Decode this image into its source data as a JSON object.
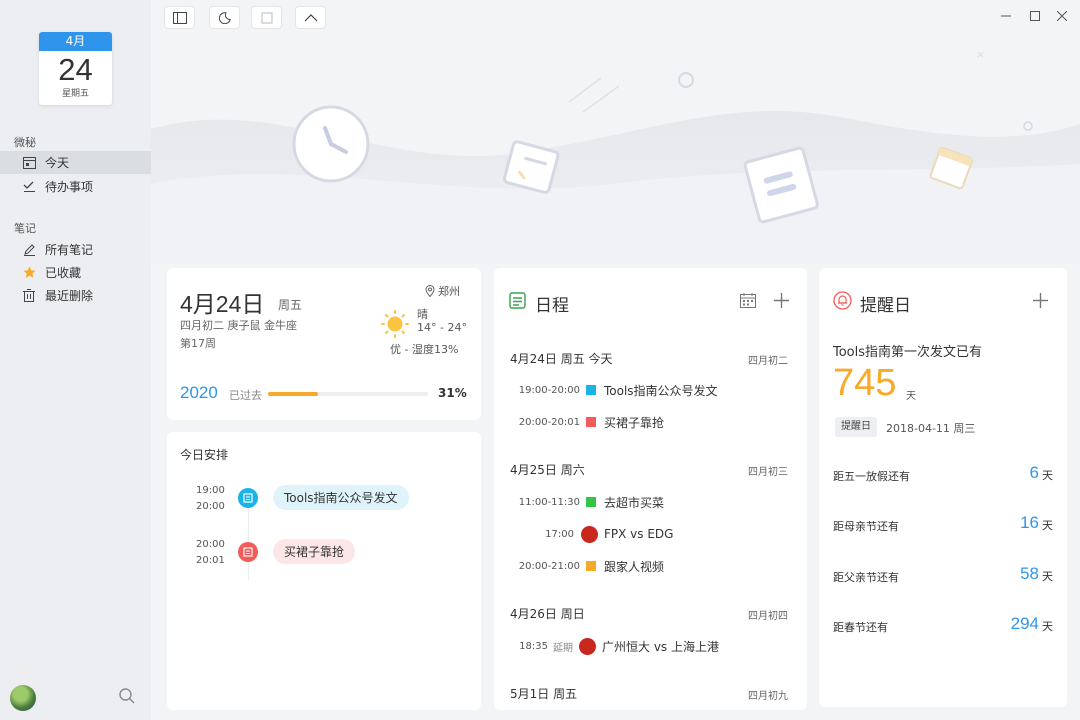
{
  "sidebar": {
    "cal_month": "4月",
    "cal_day": "24",
    "cal_weekday": "星期五",
    "section1": "微秘",
    "section2": "笔记",
    "items": [
      {
        "label": "今天",
        "icon": "calendar-icon"
      },
      {
        "label": "待办事项",
        "icon": "todo-check-icon"
      },
      {
        "label": "所有笔记",
        "icon": "pencil-icon"
      },
      {
        "label": "已收藏",
        "icon": "star-icon"
      },
      {
        "label": "最近删除",
        "icon": "trash-icon"
      }
    ]
  },
  "today": {
    "date": "4月24日",
    "weekday": "周五",
    "lunar": "四月初二 庚子鼠 金牛座",
    "week": "第17周",
    "city": "郑州",
    "weather": "晴",
    "temp": "14° - 24°",
    "air": "优 - 湿度13%",
    "year": "2020",
    "passed_label": "已过去",
    "percent": "31%",
    "progress": 0.31
  },
  "arrange": {
    "title": "今日安排",
    "items": [
      {
        "start": "19:00",
        "end": "20:00",
        "label": "Tools指南公众号发文",
        "color": "#19b3e6"
      },
      {
        "start": "20:00",
        "end": "20:01",
        "label": "买裙子靠抢",
        "color": "#f35b5b"
      }
    ]
  },
  "schedule": {
    "title": "日程",
    "days": [
      {
        "header": "4月24日 周五 今天",
        "lunar": "四月初二",
        "events": [
          {
            "time": "19:00-20:00",
            "label": "Tools指南公众号发文",
            "color": "#19b3e6"
          },
          {
            "time": "20:00-20:01",
            "label": "买裙子靠抢",
            "color": "#f35b5b"
          }
        ]
      },
      {
        "header": "4月25日 周六",
        "lunar": "四月初三",
        "events": [
          {
            "time": "11:00-11:30",
            "label": "去超市买菜",
            "color": "#35c44a"
          },
          {
            "time": "17:00",
            "label": "FPX vs EDG",
            "color": "#c8281e"
          },
          {
            "time": "20:00-21:00",
            "label": "跟家人视频",
            "color": "#f7a928"
          }
        ]
      },
      {
        "header": "4月26日 周日",
        "lunar": "四月初四",
        "events": [
          {
            "time": "18:35",
            "tag": "延期",
            "label": "广州恒大 vs 上海上港",
            "color": "#c8281e"
          }
        ]
      },
      {
        "header": "5月1日 周五",
        "lunar": "四月初九",
        "events": []
      }
    ]
  },
  "reminder": {
    "title": "提醒日",
    "headline": "Tools指南第一次发文已有",
    "days": "745",
    "days_unit": "天",
    "tag": "提醒日",
    "date": "2018-04-11 周三",
    "rows": [
      {
        "label": "距五一放假还有",
        "num": "6",
        "unit": "天"
      },
      {
        "label": "距母亲节还有",
        "num": "16",
        "unit": "天"
      },
      {
        "label": "距父亲节还有",
        "num": "58",
        "unit": "天"
      },
      {
        "label": "距春节还有",
        "num": "294",
        "unit": "天"
      }
    ]
  },
  "colors": {
    "accent": "#2f95ec",
    "orange": "#f7a928"
  }
}
